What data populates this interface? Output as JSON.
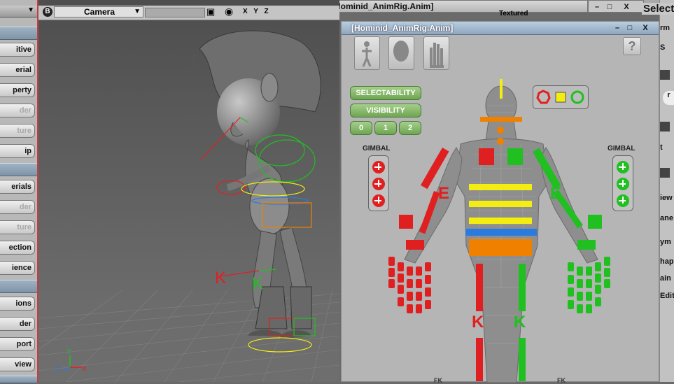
{
  "sidebar": {
    "buttons": [
      {
        "label": "itive",
        "dim": false
      },
      {
        "label": "erial",
        "dim": false
      },
      {
        "label": "perty",
        "dim": false
      },
      {
        "label": "der",
        "dim": true
      },
      {
        "label": "ture",
        "dim": true
      },
      {
        "label": "ip",
        "dim": false
      },
      {
        "label": "erials",
        "dim": false
      },
      {
        "label": "der",
        "dim": true
      },
      {
        "label": "ture",
        "dim": true
      },
      {
        "label": "ection",
        "dim": false
      },
      {
        "label": "ience",
        "dim": false
      },
      {
        "label": "ions",
        "dim": false
      },
      {
        "label": "der",
        "dim": false
      },
      {
        "label": "port",
        "dim": false
      },
      {
        "label": "view",
        "dim": false
      }
    ]
  },
  "viewport": {
    "camera_label": "Camera",
    "mode_b": "B",
    "axes_label": "X Y Z",
    "textured_label": "Textured",
    "ik_label_k": "K",
    "axis_labels": {
      "x": "X",
      "y": "Y",
      "z": "Z"
    }
  },
  "tabs": {
    "background_title": "[Hominid_AnimRig.Anim]"
  },
  "rig_window": {
    "title": "[Hominid_AnimRig.Anim]",
    "help": "?",
    "selectability": "SELECTABILITY",
    "visibility": "VISIBILITY",
    "levels": [
      "0",
      "1",
      "2"
    ],
    "gimbal_left": "GIMBAL",
    "gimbal_right": "GIMBAL",
    "elbow_left": "E",
    "elbow_right": "E",
    "knee_left": "K",
    "knee_right": "K",
    "fk_left": "FK",
    "fk_right": "FK",
    "colors": {
      "left": "#e02020",
      "right": "#20c020",
      "center": "#f4ee10",
      "spine": "#f08000",
      "hip": "#2a7ae0"
    }
  },
  "right_strip": {
    "select_label": "Select",
    "labels": [
      "rm",
      "S",
      "r",
      "t",
      "iew",
      "ane",
      "ym",
      "hap",
      "ain",
      "Edit"
    ]
  }
}
